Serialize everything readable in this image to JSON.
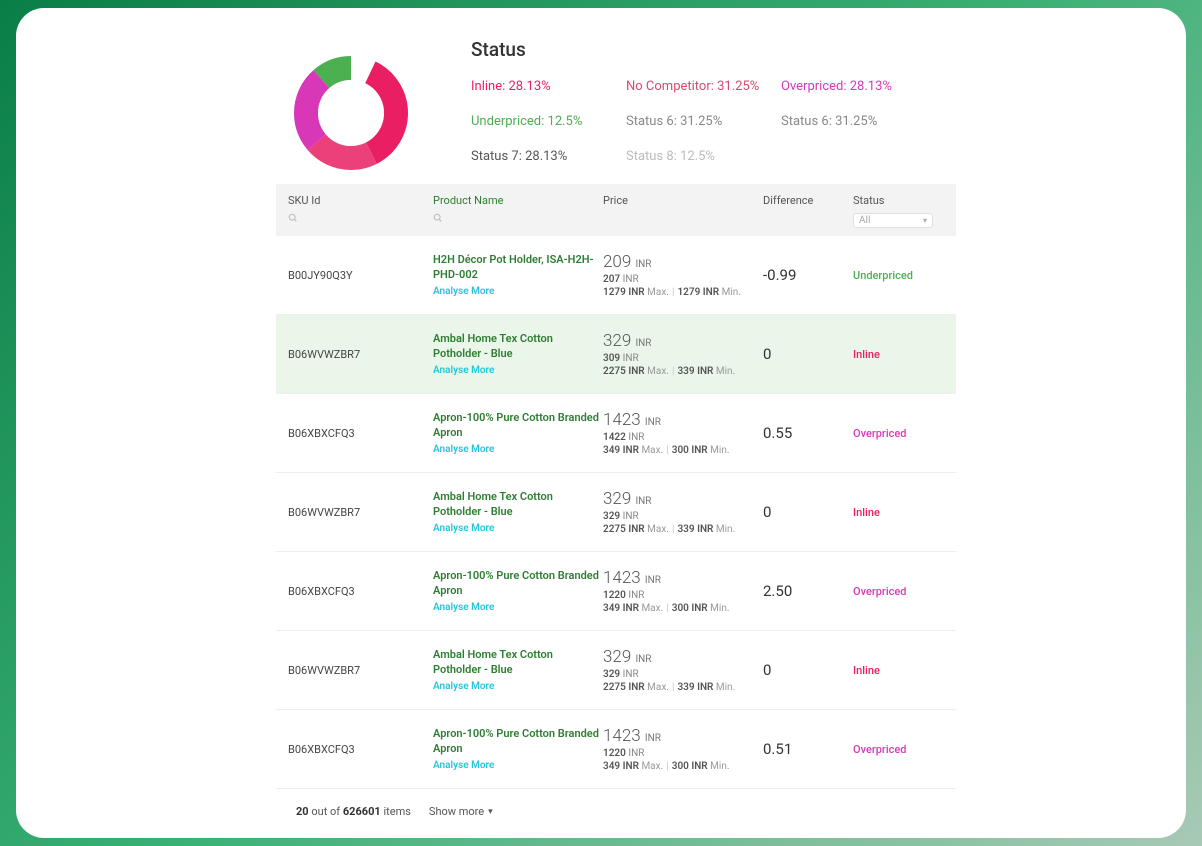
{
  "chart_data": {
    "type": "pie",
    "title": "Status",
    "categories": [
      "Inline",
      "No Competitor",
      "Overpriced",
      "Underpriced",
      "Status 6",
      "Status 6",
      "Status 7",
      "Status 8"
    ],
    "values": [
      28.13,
      31.25,
      28.13,
      12.5,
      31.25,
      31.25,
      28.13,
      12.5
    ]
  },
  "status": {
    "title": "Status",
    "legend": [
      {
        "label": "Inline: 28.13%",
        "cls": "c-inline"
      },
      {
        "label": "No Competitor: 31.25%",
        "cls": "c-nocomp"
      },
      {
        "label": "Overpriced: 28.13%",
        "cls": "c-over"
      },
      {
        "label": "Underpriced: 12.5%",
        "cls": "c-under"
      },
      {
        "label": "Status 6: 31.25%",
        "cls": "c-s6a"
      },
      {
        "label": "Status 6: 31.25%",
        "cls": "c-s6b"
      },
      {
        "label": "Status 7: 28.13%",
        "cls": "c-s7"
      },
      {
        "label": "Status 8: 12.5%",
        "cls": "c-s8"
      }
    ]
  },
  "table": {
    "headers": {
      "sku": "SKU Id",
      "product": "Product Name",
      "price": "Price",
      "diff": "Difference",
      "status": "Status",
      "filter_all": "All"
    },
    "rows": [
      {
        "sku": "B00JY90Q3Y",
        "name": "H2H Décor Pot Holder, ISA-H2H-PHD-002",
        "analyse": "Analyse More",
        "price": "209",
        "cur": "INR",
        "sub": "207",
        "max": "1279",
        "min": "1279",
        "diff": "-0.99",
        "status": "Underpriced",
        "st_cls": "st-under",
        "row_cls": ""
      },
      {
        "sku": "B06WVWZBR7",
        "name": "Ambal Home Tex Cotton Potholder - Blue",
        "analyse": "Analyse More",
        "price": "329",
        "cur": "INR",
        "sub": "309",
        "max": "2275",
        "min": "339",
        "diff": "0",
        "status": "Inline",
        "st_cls": "st-inline",
        "row_cls": "green-row"
      },
      {
        "sku": "B06XBXCFQ3",
        "name": "Apron-100% Pure Cotton Branded Apron",
        "analyse": "Analyse More",
        "price": "1423",
        "cur": "INR",
        "sub": "1422",
        "max": "349",
        "min": "300",
        "diff": "0.55",
        "status": "Overpriced",
        "st_cls": "st-over",
        "row_cls": ""
      },
      {
        "sku": "B06WVWZBR7",
        "name": "Ambal Home Tex Cotton Potholder - Blue",
        "analyse": "Analyse More",
        "price": "329",
        "cur": "INR",
        "sub": "329",
        "max": "2275",
        "min": "339",
        "diff": "0",
        "status": "Inline",
        "st_cls": "st-inline",
        "row_cls": ""
      },
      {
        "sku": "B06XBXCFQ3",
        "name": "Apron-100% Pure Cotton Branded Apron",
        "analyse": "Analyse More",
        "price": "1423",
        "cur": "INR",
        "sub": "1220",
        "max": "349",
        "min": "300",
        "diff": "2.50",
        "status": "Overpriced",
        "st_cls": "st-over",
        "row_cls": ""
      },
      {
        "sku": "B06WVWZBR7",
        "name": "Ambal Home Tex Cotton Potholder - Blue",
        "analyse": "Analyse More",
        "price": "329",
        "cur": "INR",
        "sub": "329",
        "max": "2275",
        "min": "339",
        "diff": "0",
        "status": "Inline",
        "st_cls": "st-inline",
        "row_cls": ""
      },
      {
        "sku": "B06XBXCFQ3",
        "name": "Apron-100% Pure Cotton Branded Apron",
        "analyse": "Analyse More",
        "price": "1423",
        "cur": "INR",
        "sub": "1220",
        "max": "349",
        "min": "300",
        "diff": "0.51",
        "status": "Overpriced",
        "st_cls": "st-over",
        "row_cls": ""
      }
    ]
  },
  "footer": {
    "count_shown": "20",
    "count_mid": " out of ",
    "count_total": "626601",
    "count_suffix": " items",
    "show_more": "Show more"
  },
  "labels": {
    "max": "Max.",
    "min": "Min."
  }
}
